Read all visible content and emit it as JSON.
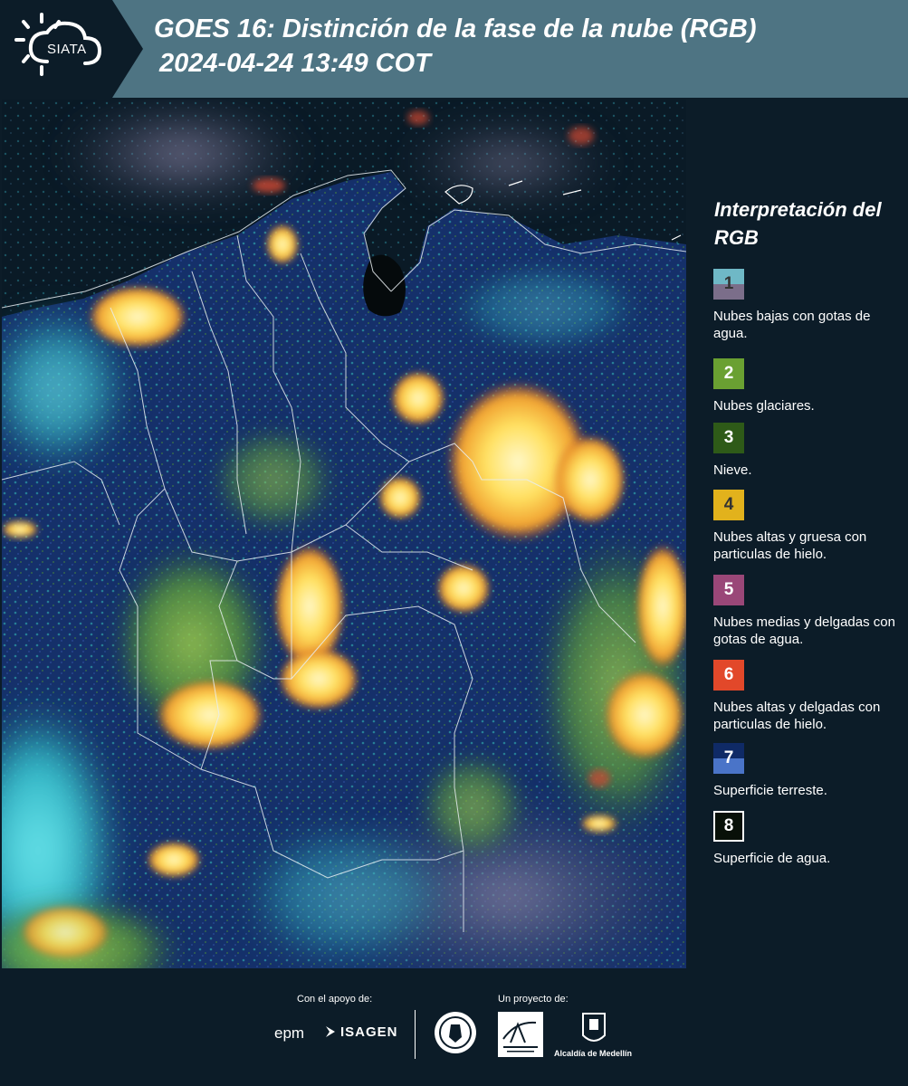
{
  "header": {
    "logo_text": "SIATA",
    "title_line1": "GOES 16: Distinción de la fase de la nube (RGB)",
    "title_line2": "2024-04-24 13:49 COT"
  },
  "legend": {
    "title": "Interpretación del RGB",
    "items": [
      {
        "number": "1",
        "label": "Nubes bajas con gotas de agua.",
        "color_top": "#6fb8c6",
        "color_bottom": "#7b6e8a",
        "text_color": "#333333"
      },
      {
        "number": "2",
        "label": "Nubes glaciares.",
        "color_top": "#6aa032",
        "color_bottom": "#6aa032",
        "text_color": "#ffffff"
      },
      {
        "number": "3",
        "label": "Nieve.",
        "color_top": "#2e5a18",
        "color_bottom": "#2e5a18",
        "text_color": "#ffffff"
      },
      {
        "number": "4",
        "label": "Nubes altas y gruesa con particulas de hielo.",
        "color_top": "#e2b21c",
        "color_bottom": "#e2b21c",
        "text_color": "#333333"
      },
      {
        "number": "5",
        "label": "Nubes medias y delgadas con gotas de agua.",
        "color_top": "#9a4778",
        "color_bottom": "#9a4778",
        "text_color": "#ffffff"
      },
      {
        "number": "6",
        "label": "Nubes altas y delgadas con particulas de hielo.",
        "color_top": "#e2482a",
        "color_bottom": "#e2482a",
        "text_color": "#ffffff"
      },
      {
        "number": "7",
        "label": "Superficie terreste.",
        "color_top": "#0f2a66",
        "color_bottom": "#4a74c8",
        "text_color": "#ffffff"
      },
      {
        "number": "8",
        "label": "Superficie de agua.",
        "color_top": "#081008",
        "color_bottom": "#081008",
        "text_color": "#ffffff"
      }
    ]
  },
  "footer": {
    "support_caption": "Con el apoyo de:",
    "project_caption": "Un proyecto de:",
    "sponsor_1": "epm",
    "sponsor_2": "ISAGEN",
    "partner_area": "Área Metropolitana Valle de Aburrá",
    "partner_alcaldia": "Alcaldía de Medellín"
  },
  "colors": {
    "background": "#0c1c28",
    "header_band": "#4e7483",
    "cloud_bright": "#ffe56a",
    "cloud_core": "#fff3b0",
    "low_cloud": "#39c8d2",
    "land": "#16306a"
  }
}
